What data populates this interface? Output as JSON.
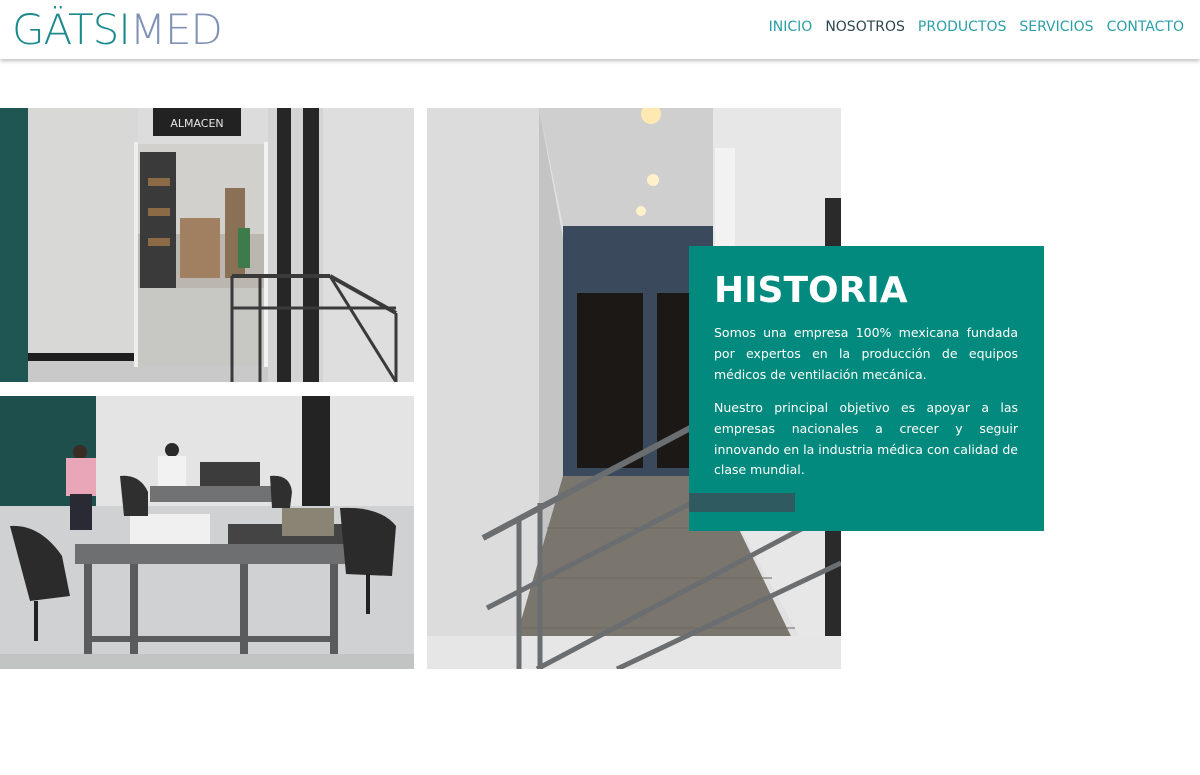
{
  "header": {
    "logo_part1": "GÄTSI",
    "logo_part2": "MED"
  },
  "nav": {
    "items": [
      {
        "label": "INICIO",
        "active": false
      },
      {
        "label": "NOSOTROS",
        "active": true
      },
      {
        "label": "PRODUCTOS",
        "active": false
      },
      {
        "label": "SERVICIOS",
        "active": false
      },
      {
        "label": "CONTACTO",
        "active": false
      }
    ]
  },
  "photos": {
    "warehouse_sign": "ALMACEN"
  },
  "historia": {
    "title": "HISTORIA",
    "paragraph1": "Somos una empresa 100% mexicana fundada por expertos en la producción de equipos médicos de ventilación mecánica.",
    "paragraph2": "Nuestro principal objetivo es apoyar a las empresas nacionales a crecer y seguir innovando en la industria médica con calidad de clase mundial."
  },
  "colors": {
    "brand_teal": "#1b8a8c",
    "brand_blue": "#8092b6",
    "nav_link": "#2b9fa7",
    "nav_active": "#2d4750",
    "card_background": "#028a7e",
    "card_accent_bar": "#2f5a60"
  }
}
